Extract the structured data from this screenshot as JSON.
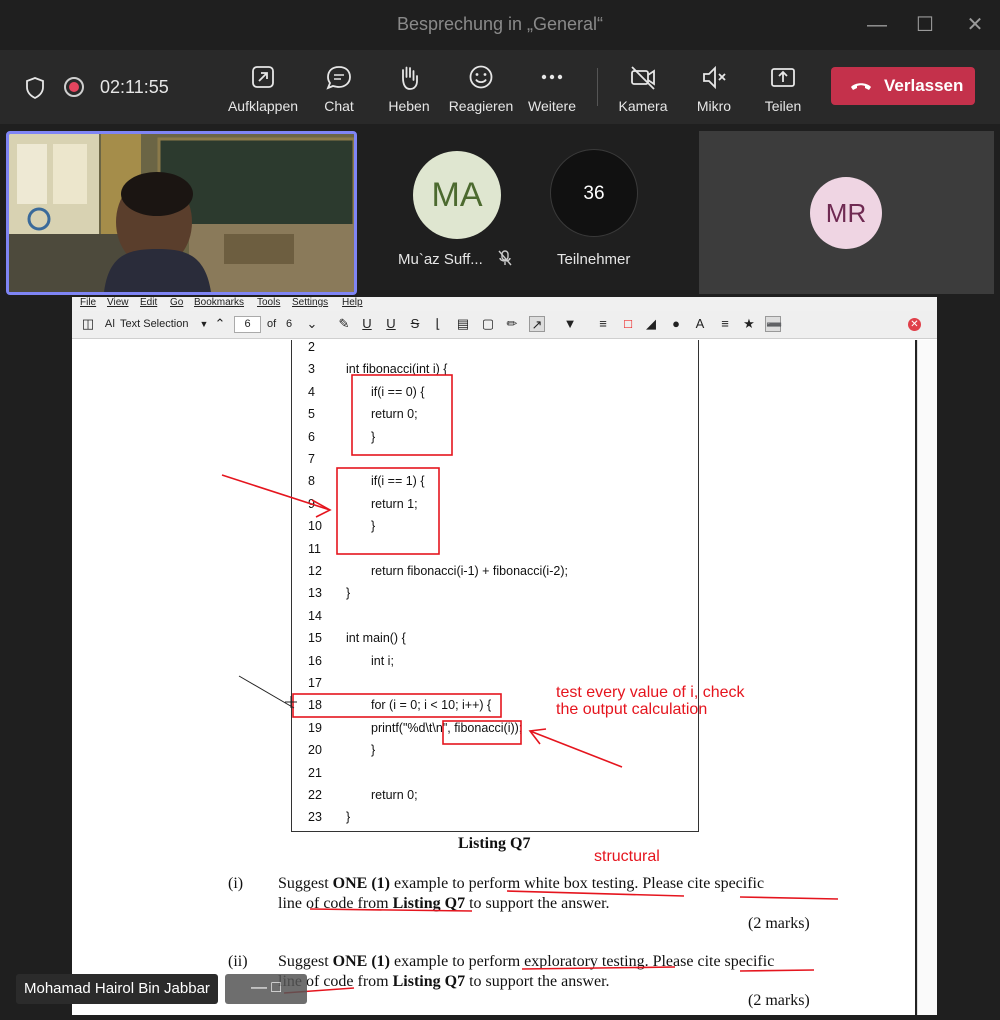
{
  "window": {
    "title": "Besprechung in „General“"
  },
  "meeting": {
    "timer": "02:11:55",
    "buttons": {
      "expand": "Aufklappen",
      "chat": "Chat",
      "raise_hand": "Heben",
      "react": "Reagieren",
      "more": "Weitere",
      "camera": "Kamera",
      "mic": "Mikro",
      "share": "Teilen"
    },
    "leave_label": "Verlassen",
    "leave_color": "#c4314b"
  },
  "participants": {
    "ma": {
      "initials": "MA",
      "name": "Mu`az Suff..."
    },
    "count": {
      "value": "36",
      "label": "Teilnehmer"
    },
    "mr": {
      "initials": "MR"
    }
  },
  "viewer": {
    "menu": [
      "File",
      "View",
      "Edit",
      "Go",
      "Bookmarks",
      "Tools",
      "Settings",
      "Help"
    ],
    "toolbar": {
      "mode": "Text Selection",
      "page": "6",
      "of": "of",
      "total": "6"
    }
  },
  "document": {
    "code": [
      {
        "n": "2",
        "code": "",
        "indent": 0
      },
      {
        "n": "3",
        "code": "int fibonacci(int i) {",
        "indent": 1
      },
      {
        "n": "4",
        "code": "if(i == 0) {",
        "indent": 2
      },
      {
        "n": "5",
        "code": "return 0;",
        "indent": 2
      },
      {
        "n": "6",
        "code": "}",
        "indent": 2
      },
      {
        "n": "7",
        "code": "",
        "indent": 0
      },
      {
        "n": "8",
        "code": "if(i == 1) {",
        "indent": 2
      },
      {
        "n": "9",
        "code": "return 1;",
        "indent": 2
      },
      {
        "n": "10",
        "code": "}",
        "indent": 2
      },
      {
        "n": "11",
        "code": "",
        "indent": 0
      },
      {
        "n": "12",
        "code": "return fibonacci(i-1) + fibonacci(i-2);",
        "indent": 2
      },
      {
        "n": "13",
        "code": "}",
        "indent": 1
      },
      {
        "n": "14",
        "code": "",
        "indent": 0
      },
      {
        "n": "15",
        "code": "int main() {",
        "indent": 1
      },
      {
        "n": "16",
        "code": "int i;",
        "indent": 2
      },
      {
        "n": "17",
        "code": "",
        "indent": 0
      },
      {
        "n": "18",
        "code": "for (i = 0; i < 10; i++) {",
        "indent": 2
      },
      {
        "n": "19",
        "code": "printf(\"%d\\t\\n\", fibonacci(i));",
        "indent": 2
      },
      {
        "n": "20",
        "code": "}",
        "indent": 2
      },
      {
        "n": "21",
        "code": "",
        "indent": 0
      },
      {
        "n": "22",
        "code": "return 0;",
        "indent": 2
      },
      {
        "n": "23",
        "code": "}",
        "indent": 1
      }
    ],
    "caption": "Listing Q7",
    "q1": {
      "num": "(i)",
      "line1": "Suggest <b>ONE (1)</b> example to perform white box testing. Please cite specific",
      "line2": "line of code from <b>Listing Q7</b> to support the answer.",
      "marks": "(2 marks)"
    },
    "q2": {
      "num": "(ii)",
      "line1": "Suggest <b>ONE (1)</b> example to perform exploratory testing. Please cite specific",
      "line2": "line of code from <b>Listing Q7</b> to support the answer.",
      "marks": "(2 marks)"
    },
    "annotations": {
      "note1": "test every value of i, check",
      "note2": "the output calculation",
      "note3": "structural"
    },
    "ink_color": "#e5151e"
  },
  "presenter": {
    "name": "Mohamad Hairol Bin Jabbar"
  }
}
